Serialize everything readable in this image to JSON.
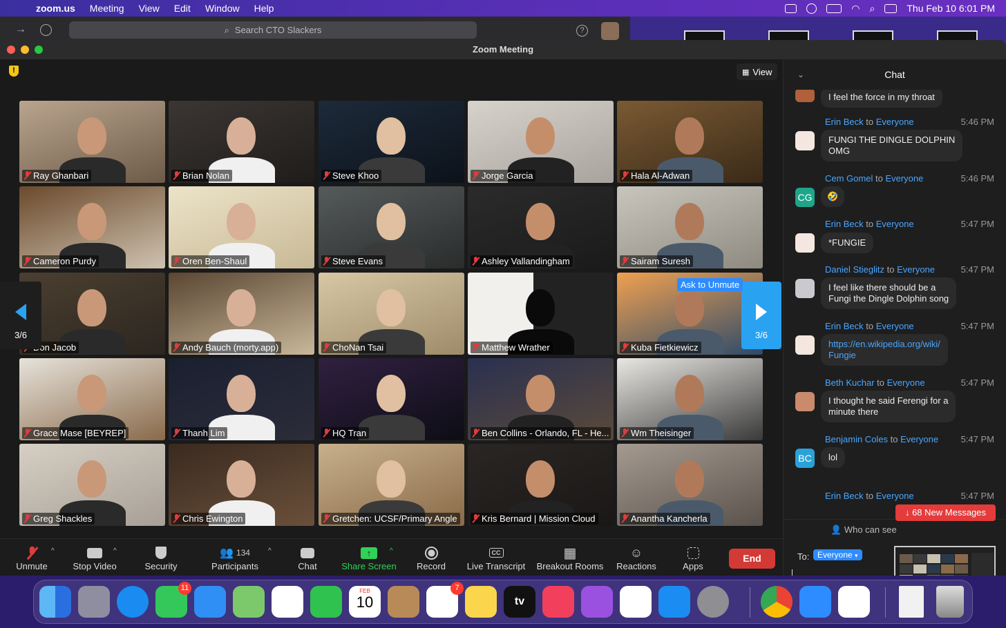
{
  "menubar": {
    "app": "zoom.us",
    "items": [
      "Meeting",
      "View",
      "Edit",
      "Window",
      "Help"
    ],
    "clock": "Thu Feb 10  6:01 PM"
  },
  "browser": {
    "search_placeholder": "Search CTO Slackers"
  },
  "window": {
    "title": "Zoom Meeting"
  },
  "view_button": "View",
  "participants": [
    {
      "name": "Ray Ghanbari"
    },
    {
      "name": "Brian Nolan"
    },
    {
      "name": "Steve Khoo"
    },
    {
      "name": "Jorge Garcia"
    },
    {
      "name": "Hala Al-Adwan"
    },
    {
      "name": "Cameron Purdy"
    },
    {
      "name": "Oren Ben-Shaul"
    },
    {
      "name": "Steve Evans"
    },
    {
      "name": "Ashley Vallandingham"
    },
    {
      "name": "Sairam Suresh"
    },
    {
      "name": "Don Jacob"
    },
    {
      "name": "Andy Bauch (morty.app)"
    },
    {
      "name": "ChoNan Tsai"
    },
    {
      "name": "Matthew Wrather"
    },
    {
      "name": "Kuba Fietkiewicz"
    },
    {
      "name": "Grace Mase [BEYREP]"
    },
    {
      "name": "Thanh Lim"
    },
    {
      "name": "HQ Tran"
    },
    {
      "name": "Ben Collins - Orlando, FL - He..."
    },
    {
      "name": "Wm Theisinger"
    },
    {
      "name": "Greg Shackles"
    },
    {
      "name": "Chris Ewington"
    },
    {
      "name": "Gretchen: UCSF/Primary Angle"
    },
    {
      "name": "Kris Bernard | Mission Cloud"
    },
    {
      "name": "Anantha Kancherla"
    }
  ],
  "pager": {
    "prev_label": "3/6",
    "next_label": "3/6"
  },
  "ask_to_unmute": "Ask to Unmute",
  "toolbar": {
    "unmute": "Unmute",
    "stop_video": "Stop Video",
    "security": "Security",
    "participants": "Participants",
    "participant_count": "134",
    "chat": "Chat",
    "share_screen": "Share Screen",
    "record": "Record",
    "live_transcript": "Live Transcript",
    "cc": "CC",
    "breakout_rooms": "Breakout Rooms",
    "reactions": "Reactions",
    "apps": "Apps",
    "end": "End"
  },
  "chat": {
    "title": "Chat",
    "messages": [
      {
        "text": "I feel the force in my throat"
      },
      {
        "sender": "Erin Beck",
        "to": "to",
        "recipient": "Everyone",
        "time": "5:46 PM",
        "line1": "FUNGI THE DINGLE DOLPHIN",
        "line2": "OMG"
      },
      {
        "sender": "Cem Gomel",
        "to": "to",
        "recipient": "Everyone",
        "time": "5:46 PM",
        "avatar": "CG",
        "text": "🤣"
      },
      {
        "sender": "Erin Beck",
        "to": "to",
        "recipient": "Everyone",
        "time": "5:47 PM",
        "text": "*FUNGIE"
      },
      {
        "sender": "Daniel Stieglitz",
        "to": "to",
        "recipient": "Everyone",
        "time": "5:47 PM",
        "line1": "I feel like there should be a",
        "line2": "Fungi the Dingle Dolphin song"
      },
      {
        "sender": "Erin Beck",
        "to": "to",
        "recipient": "Everyone",
        "time": "5:47 PM",
        "line1": "https://en.wikipedia.org/wiki/",
        "line2": "Fungie"
      },
      {
        "sender": "Beth Kuchar",
        "to": "to",
        "recipient": "Everyone",
        "time": "5:47 PM",
        "line1": "I thought he said Ferengi for a",
        "line2": "minute there"
      },
      {
        "sender": "Benjamin Coles",
        "to": "to",
        "recipient": "Everyone",
        "time": "5:47 PM",
        "avatar": "BC",
        "text": "lol"
      },
      {
        "sender": "Erin Beck",
        "to": "to",
        "recipient": "Everyone",
        "time": "5:47 PM"
      }
    ],
    "new_messages": "68 New Messages",
    "who_can_see": "Who can see",
    "to_label": "To:",
    "recipient": "Everyone"
  },
  "dock": {
    "messages_badge": "11",
    "reminders_badge": "7",
    "calendar_month": "FEB",
    "calendar_day": "10",
    "tv_label": "tv"
  }
}
